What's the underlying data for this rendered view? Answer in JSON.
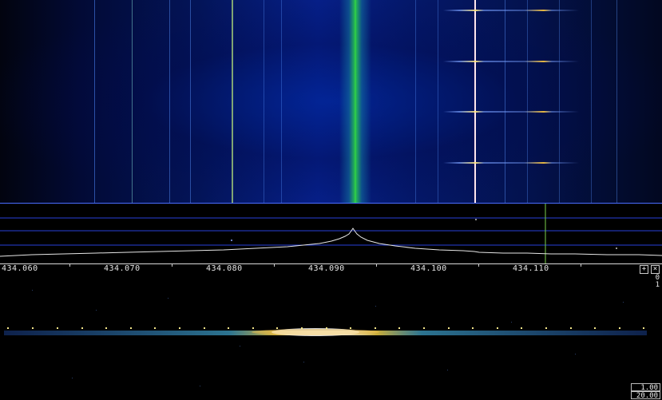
{
  "frequency_axis": {
    "labels": [
      "434.060",
      "434.070",
      "434.080",
      "434.090",
      "434.100",
      "434.110"
    ]
  },
  "buttons": {
    "plus_label": "+",
    "close_label": "×"
  },
  "lower_display": {
    "scale_top": "0",
    "scale_second": "1",
    "value_upper": "1.00",
    "value_lower": "20.00"
  },
  "colors": {
    "carrier": "#22c43a",
    "marker_line": "#ffe8ee",
    "spectrum_trace": "#e8e8e8",
    "grid": "#3050ff",
    "cursor": "#7ad04a"
  },
  "icons": {
    "plus": "plus-icon",
    "close": "close-icon"
  }
}
